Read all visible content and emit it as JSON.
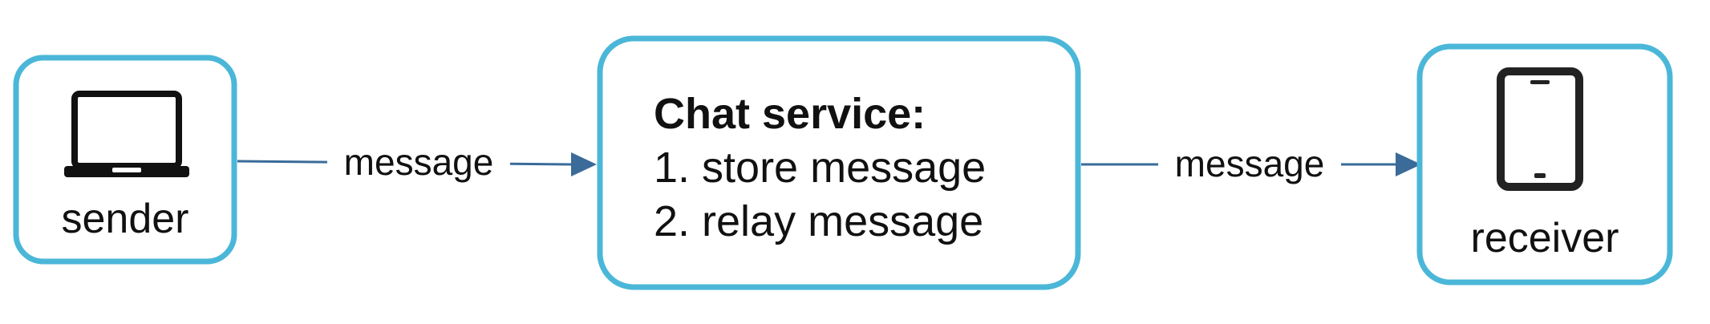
{
  "nodes": {
    "sender": {
      "label": "sender",
      "icon": "laptop-icon"
    },
    "chat_service": {
      "title": "Chat service:",
      "steps": [
        "1. store message",
        "2. relay message"
      ]
    },
    "receiver": {
      "label": "receiver",
      "icon": "smartphone-icon"
    }
  },
  "edges": [
    {
      "from": "sender",
      "to": "chat_service",
      "label": "message"
    },
    {
      "from": "chat_service",
      "to": "receiver",
      "label": "message"
    }
  ],
  "colors": {
    "box_stroke": "#4bb7d8",
    "arrow": "#3a6b99",
    "text": "#111111"
  }
}
